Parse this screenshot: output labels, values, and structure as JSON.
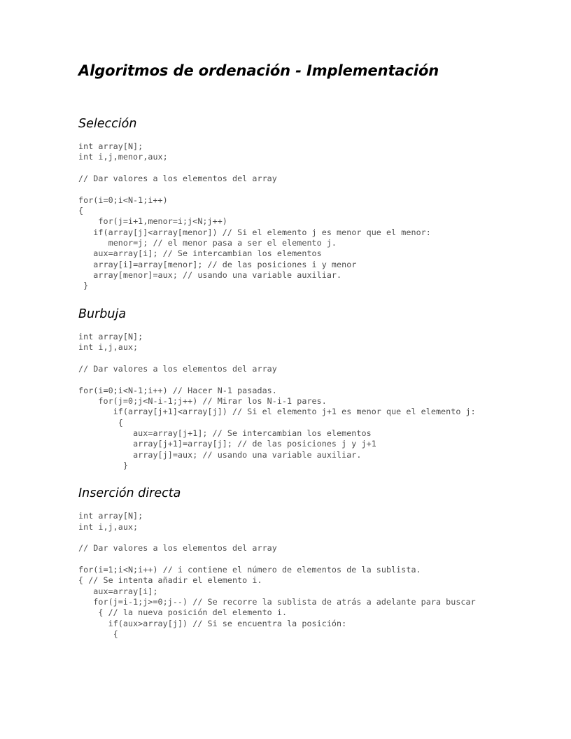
{
  "document": {
    "title": "Algoritmos de ordenación - Implementación",
    "background_color": "#ffffff",
    "text_color": "#000000",
    "code_color": "#4d4d4d"
  },
  "sections": [
    {
      "heading": "Selección",
      "code": "int array[N];\nint i,j,menor,aux;\n\n// Dar valores a los elementos del array\n\nfor(i=0;i<N-1;i++)\n{\n    for(j=i+1,menor=i;j<N;j++)\n   if(array[j]<array[menor]) // Si el elemento j es menor que el menor:\n      menor=j; // el menor pasa a ser el elemento j.\n   aux=array[i]; // Se intercambian los elementos\n   array[i]=array[menor]; // de las posiciones i y menor\n   array[menor]=aux; // usando una variable auxiliar.\n }"
    },
    {
      "heading": "Burbuja",
      "code": "int array[N];\nint i,j,aux;\n\n// Dar valores a los elementos del array\n\nfor(i=0;i<N-1;i++) // Hacer N-1 pasadas.\n    for(j=0;j<N-i-1;j++) // Mirar los N-i-1 pares.\n       if(array[j+1]<array[j]) // Si el elemento j+1 es menor que el elemento j:\n        {\n           aux=array[j+1]; // Se intercambian los elementos\n           array[j+1]=array[j]; // de las posiciones j y j+1\n           array[j]=aux; // usando una variable auxiliar.\n         }"
    },
    {
      "heading": "Inserción directa",
      "code": "int array[N];\nint i,j,aux;\n\n// Dar valores a los elementos del array\n\nfor(i=1;i<N;i++) // i contiene el número de elementos de la sublista.\n{ // Se intenta añadir el elemento i.\n   aux=array[i];\n   for(j=i-1;j>=0;j--) // Se recorre la sublista de atrás a adelante para buscar\n    { // la nueva posición del elemento i.\n      if(aux>array[j]) // Si se encuentra la posición:\n       {"
    }
  ]
}
